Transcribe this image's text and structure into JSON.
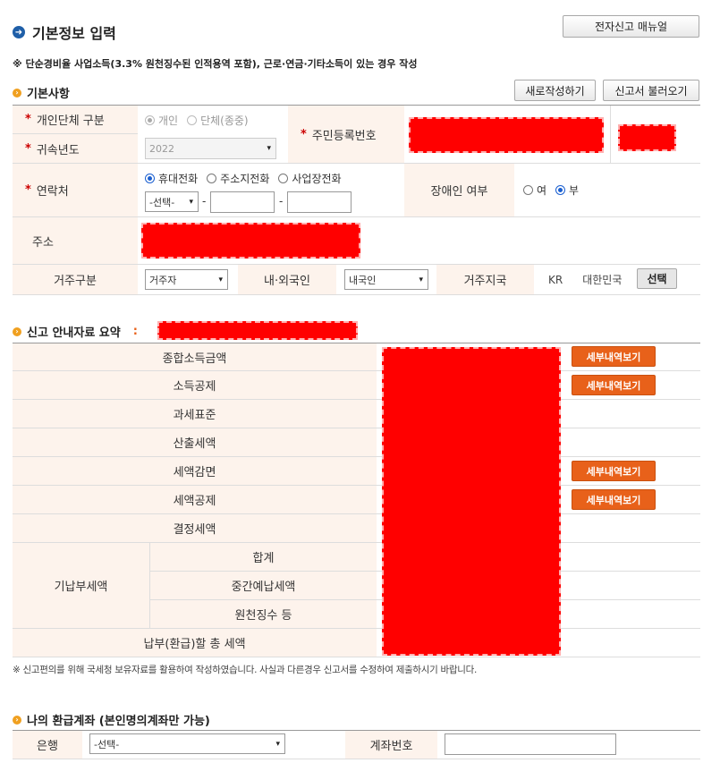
{
  "header": {
    "title": "기본정보 입력",
    "manual_button": "전자신고 매뉴얼"
  },
  "note": "※ 단순경비율 사업소득(3.3% 원천징수된 인적용역 포함), 근로·연금·기타소득이 있는 경우 작성",
  "basic": {
    "section_title": "기본사항",
    "new_button": "새로작성하기",
    "load_button": "신고서 불러오기",
    "type_label": "개인단체 구분",
    "type_options": [
      "개인",
      "단체(종중)"
    ],
    "year_label": "귀속년도",
    "year_value": "2022",
    "rrn_label": "주민등록번호",
    "contact_label": "연락처",
    "contact_options": [
      "휴대전화",
      "주소지전화",
      "사업장전화"
    ],
    "phone_select": "-선택-",
    "dash": "-",
    "disabled_label": "장애인 여부",
    "disabled_options": [
      "여",
      "부"
    ],
    "address_label": "주소",
    "residence_label": "거주구분",
    "residence_value": "거주자",
    "nationality_label": "내·외국인",
    "nationality_value": "내국인",
    "region_label": "거주지국",
    "region_code": "KR",
    "region_name": "대한민국",
    "select_button": "선택"
  },
  "summary": {
    "section_title": "신고 안내자료 요약",
    "colon": ":",
    "rows": [
      {
        "label": "종합소득금액",
        "button": "세부내역보기"
      },
      {
        "label": "소득공제",
        "button": "세부내역보기"
      },
      {
        "label": "과세표준",
        "button": ""
      },
      {
        "label": "산출세액",
        "button": ""
      },
      {
        "label": "세액감면",
        "button": "세부내역보기"
      },
      {
        "label": "세액공제",
        "button": "세부내역보기"
      },
      {
        "label": "결정세액",
        "button": ""
      }
    ],
    "prepaid_label": "기납부세액",
    "prepaid_rows": [
      "합계",
      "중간예납세액",
      "원천징수 등"
    ],
    "total_label": "납부(환급)할 총 세액",
    "footnote": "※ 신고편의를 위해 국세청 보유자료를 활용하여 작성하였습니다. 사실과 다른경우 신고서를 수정하여 제출하시기 바랍니다."
  },
  "refund": {
    "section_title": "나의 환급계좌 (본인명의계좌만 가능)",
    "bank_label": "은행",
    "bank_select": "-선택-",
    "account_label": "계좌번호"
  }
}
